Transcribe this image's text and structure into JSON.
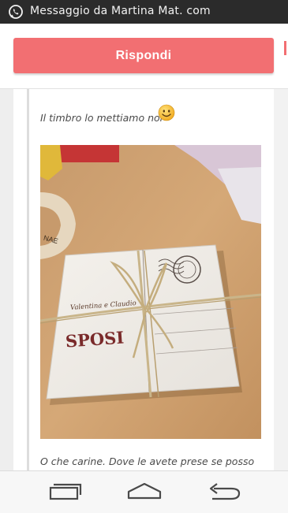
{
  "status_bar": {
    "app_icon": "whatsapp-icon",
    "title": "Messaggio da Martina Mat. com"
  },
  "actions": {
    "reply_label": "Rispondi"
  },
  "thread": {
    "message_1": "Il timbro lo mettiamo noi",
    "message_1_emoji": "smiley-icon",
    "photo": {
      "card_names": "Valentina e Claudio",
      "card_title": "SPOSI",
      "tape_text": "NAE"
    },
    "message_2": "O che carine. Dove le avete prese se posso"
  },
  "navigation": {
    "back_icon": "recent-apps-icon",
    "home_icon": "home-icon",
    "return_icon": "back-icon"
  },
  "colors": {
    "accent": "#f26f72",
    "status_bar": "#2b2b2b",
    "text": "#4a4a4a"
  }
}
